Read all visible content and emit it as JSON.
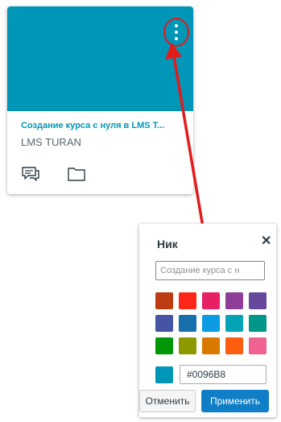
{
  "colors": {
    "hero": "#0096B8",
    "accent": "#0096B8",
    "annotation": "#E21B1B",
    "apply_button": "#0f7ec6"
  },
  "card": {
    "title": "Создание курса с нуля в LMS T...",
    "subtitle": "LMS TURAN",
    "menu_icon": "kebab-menu-icon",
    "icons": [
      "discussion-icon",
      "folder-icon"
    ]
  },
  "popup": {
    "title": "Ник",
    "close_icon": "close-icon",
    "nickname_placeholder": "Создание курса с н",
    "swatches": [
      "#BD3C14",
      "#FF2717",
      "#E71F63",
      "#8F3E97",
      "#65499D",
      "#4554A4",
      "#1770AB",
      "#0B9BE3",
      "#06A3B7",
      "#009688",
      "#009606",
      "#8D9900",
      "#D97900",
      "#FD5D10",
      "#F06291"
    ],
    "hex_value": "#0096B8",
    "cancel_label": "Отменить",
    "apply_label": "Применить"
  }
}
